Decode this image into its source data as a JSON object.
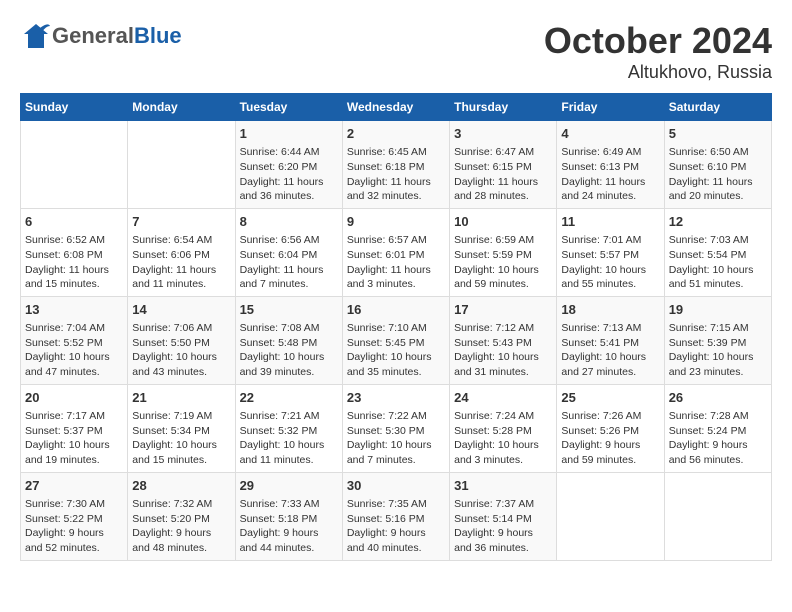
{
  "title": "October 2024",
  "subtitle": "Altukhovo, Russia",
  "logo": {
    "general": "General",
    "blue": "Blue"
  },
  "weekdays": [
    "Sunday",
    "Monday",
    "Tuesday",
    "Wednesday",
    "Thursday",
    "Friday",
    "Saturday"
  ],
  "weeks": [
    [
      {
        "day": "",
        "info": ""
      },
      {
        "day": "",
        "info": ""
      },
      {
        "day": "1",
        "info": "Sunrise: 6:44 AM\nSunset: 6:20 PM\nDaylight: 11 hours\nand 36 minutes."
      },
      {
        "day": "2",
        "info": "Sunrise: 6:45 AM\nSunset: 6:18 PM\nDaylight: 11 hours\nand 32 minutes."
      },
      {
        "day": "3",
        "info": "Sunrise: 6:47 AM\nSunset: 6:15 PM\nDaylight: 11 hours\nand 28 minutes."
      },
      {
        "day": "4",
        "info": "Sunrise: 6:49 AM\nSunset: 6:13 PM\nDaylight: 11 hours\nand 24 minutes."
      },
      {
        "day": "5",
        "info": "Sunrise: 6:50 AM\nSunset: 6:10 PM\nDaylight: 11 hours\nand 20 minutes."
      }
    ],
    [
      {
        "day": "6",
        "info": "Sunrise: 6:52 AM\nSunset: 6:08 PM\nDaylight: 11 hours\nand 15 minutes."
      },
      {
        "day": "7",
        "info": "Sunrise: 6:54 AM\nSunset: 6:06 PM\nDaylight: 11 hours\nand 11 minutes."
      },
      {
        "day": "8",
        "info": "Sunrise: 6:56 AM\nSunset: 6:04 PM\nDaylight: 11 hours\nand 7 minutes."
      },
      {
        "day": "9",
        "info": "Sunrise: 6:57 AM\nSunset: 6:01 PM\nDaylight: 11 hours\nand 3 minutes."
      },
      {
        "day": "10",
        "info": "Sunrise: 6:59 AM\nSunset: 5:59 PM\nDaylight: 10 hours\nand 59 minutes."
      },
      {
        "day": "11",
        "info": "Sunrise: 7:01 AM\nSunset: 5:57 PM\nDaylight: 10 hours\nand 55 minutes."
      },
      {
        "day": "12",
        "info": "Sunrise: 7:03 AM\nSunset: 5:54 PM\nDaylight: 10 hours\nand 51 minutes."
      }
    ],
    [
      {
        "day": "13",
        "info": "Sunrise: 7:04 AM\nSunset: 5:52 PM\nDaylight: 10 hours\nand 47 minutes."
      },
      {
        "day": "14",
        "info": "Sunrise: 7:06 AM\nSunset: 5:50 PM\nDaylight: 10 hours\nand 43 minutes."
      },
      {
        "day": "15",
        "info": "Sunrise: 7:08 AM\nSunset: 5:48 PM\nDaylight: 10 hours\nand 39 minutes."
      },
      {
        "day": "16",
        "info": "Sunrise: 7:10 AM\nSunset: 5:45 PM\nDaylight: 10 hours\nand 35 minutes."
      },
      {
        "day": "17",
        "info": "Sunrise: 7:12 AM\nSunset: 5:43 PM\nDaylight: 10 hours\nand 31 minutes."
      },
      {
        "day": "18",
        "info": "Sunrise: 7:13 AM\nSunset: 5:41 PM\nDaylight: 10 hours\nand 27 minutes."
      },
      {
        "day": "19",
        "info": "Sunrise: 7:15 AM\nSunset: 5:39 PM\nDaylight: 10 hours\nand 23 minutes."
      }
    ],
    [
      {
        "day": "20",
        "info": "Sunrise: 7:17 AM\nSunset: 5:37 PM\nDaylight: 10 hours\nand 19 minutes."
      },
      {
        "day": "21",
        "info": "Sunrise: 7:19 AM\nSunset: 5:34 PM\nDaylight: 10 hours\nand 15 minutes."
      },
      {
        "day": "22",
        "info": "Sunrise: 7:21 AM\nSunset: 5:32 PM\nDaylight: 10 hours\nand 11 minutes."
      },
      {
        "day": "23",
        "info": "Sunrise: 7:22 AM\nSunset: 5:30 PM\nDaylight: 10 hours\nand 7 minutes."
      },
      {
        "day": "24",
        "info": "Sunrise: 7:24 AM\nSunset: 5:28 PM\nDaylight: 10 hours\nand 3 minutes."
      },
      {
        "day": "25",
        "info": "Sunrise: 7:26 AM\nSunset: 5:26 PM\nDaylight: 9 hours\nand 59 minutes."
      },
      {
        "day": "26",
        "info": "Sunrise: 7:28 AM\nSunset: 5:24 PM\nDaylight: 9 hours\nand 56 minutes."
      }
    ],
    [
      {
        "day": "27",
        "info": "Sunrise: 7:30 AM\nSunset: 5:22 PM\nDaylight: 9 hours\nand 52 minutes."
      },
      {
        "day": "28",
        "info": "Sunrise: 7:32 AM\nSunset: 5:20 PM\nDaylight: 9 hours\nand 48 minutes."
      },
      {
        "day": "29",
        "info": "Sunrise: 7:33 AM\nSunset: 5:18 PM\nDaylight: 9 hours\nand 44 minutes."
      },
      {
        "day": "30",
        "info": "Sunrise: 7:35 AM\nSunset: 5:16 PM\nDaylight: 9 hours\nand 40 minutes."
      },
      {
        "day": "31",
        "info": "Sunrise: 7:37 AM\nSunset: 5:14 PM\nDaylight: 9 hours\nand 36 minutes."
      },
      {
        "day": "",
        "info": ""
      },
      {
        "day": "",
        "info": ""
      }
    ]
  ]
}
